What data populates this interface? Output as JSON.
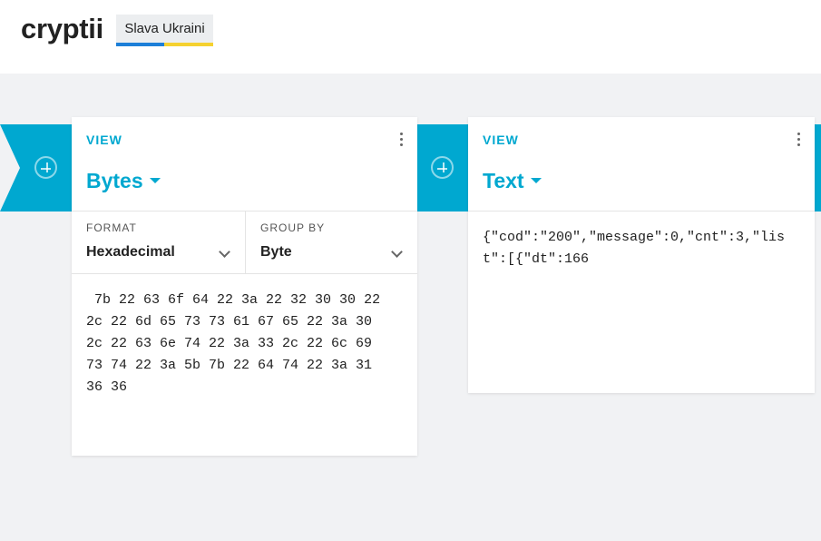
{
  "header": {
    "logo": "cryptii",
    "badge": "Slava Ukraini"
  },
  "colors": {
    "accent": "#00a8d0",
    "background": "#f1f2f4",
    "badge_blue": "#1d7fd8",
    "badge_yellow": "#f5d130"
  },
  "pipeline": {
    "add_icon": "plus-circle-icon"
  },
  "bytes_view": {
    "section_label": "VIEW",
    "title": "Bytes",
    "menu_icon": "more-vertical-icon",
    "format_label": "FORMAT",
    "format_value": "Hexadecimal",
    "group_label": "GROUP BY",
    "group_value": "Byte",
    "content": " 7b 22 63 6f 64 22 3a 22 32 30 30 22\n2c 22 6d 65 73 73 61 67 65 22 3a 30\n2c 22 63 6e 74 22 3a 33 2c 22 6c 69\n73 74 22 3a 5b 7b 22 64 74 22 3a 31\n36 36"
  },
  "text_view": {
    "section_label": "VIEW",
    "title": "Text",
    "menu_icon": "more-vertical-icon",
    "content": "{\"cod\":\"200\",\"message\":0,\"cnt\":3,\"list\":[{\"dt\":166"
  }
}
